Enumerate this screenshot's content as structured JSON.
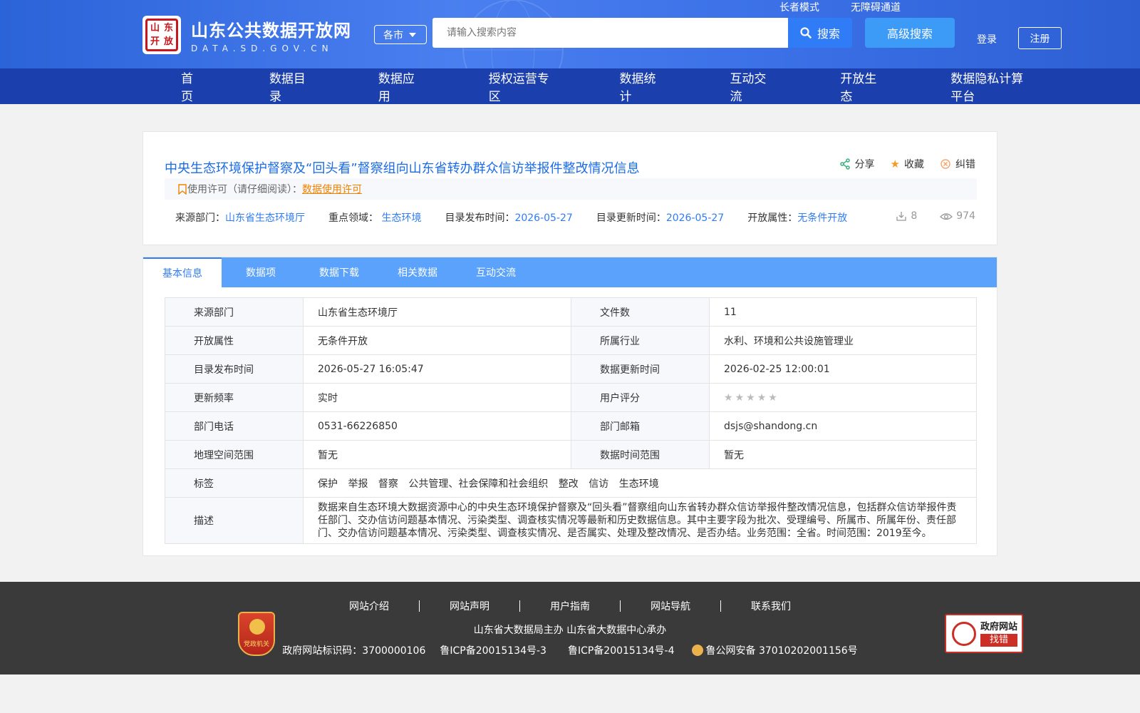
{
  "header": {
    "site_title": "山东公共数据开放网",
    "site_domain": "DATA.SD.GOV.CN",
    "logo_seal_chars": [
      "山",
      "东",
      "开",
      "放"
    ],
    "elder_mode": "长者模式",
    "accessibility": "无障碍通道",
    "city_select": "各市",
    "search_placeholder": "请输入搜索内容",
    "search_button": "搜索",
    "advanced_search": "高级搜索",
    "login": "登录",
    "register": "注册"
  },
  "nav": {
    "items": [
      "首页",
      "数据目录",
      "数据应用",
      "授权运营专区",
      "数据统计",
      "互动交流",
      "开放生态",
      "数据隐私计算平台"
    ]
  },
  "dataset": {
    "title": "中央生态环境保护督察及“回头看”督察组向山东省转办群众信访举报件整改情况信息",
    "share": "分享",
    "favorite": "收藏",
    "report": "纠错",
    "license_prefix": "使用许可（请仔细阅读）：",
    "license_link": "数据使用许可",
    "meta": {
      "source_label": "来源部门：",
      "source_value": "山东省生态环境厅",
      "domain_label": "重点领域：",
      "domain_value": "生态环境",
      "publish_label": "目录发布时间：",
      "publish_value": "2026-05-27",
      "update_label": "目录更新时间：",
      "update_value": "2026-05-27",
      "open_label": "开放属性：",
      "open_value": "无条件开放",
      "downloads": "8",
      "views": "974"
    }
  },
  "tabs": [
    "基本信息",
    "数据项",
    "数据下载",
    "相关数据",
    "互动交流"
  ],
  "details": {
    "rows": [
      {
        "k1": "来源部门",
        "v1": "山东省生态环境厅",
        "k2": "文件数",
        "v2": "11"
      },
      {
        "k1": "开放属性",
        "v1": "无条件开放",
        "k2": "所属行业",
        "v2": "水利、环境和公共设施管理业"
      },
      {
        "k1": "目录发布时间",
        "v1": "2026-05-27 16:05:47",
        "k2": "数据更新时间",
        "v2": "2026-02-25 12:00:01"
      },
      {
        "k1": "更新频率",
        "v1": "实时",
        "k2": "用户评分",
        "v2": ""
      },
      {
        "k1": "部门电话",
        "v1": "0531-66226850",
        "k2": "部门邮箱",
        "v2": "dsjs@shandong.cn"
      },
      {
        "k1": "地理空间范围",
        "v1": "暂无",
        "k2": "数据时间范围",
        "v2": "暂无"
      }
    ],
    "rating": 0,
    "tags_label": "标签",
    "tags": [
      "保护",
      "举报",
      "督察",
      "公共管理、社会保障和社会组织",
      "整改",
      "信访",
      "生态环境"
    ],
    "desc_label": "描述",
    "desc": "数据来自生态环境大数据资源中心的中央生态环境保护督察及“回头看”督察组向山东省转办群众信访举报件整改情况信息，包括群众信访举报件责任部门、交办信访问题基本情况、污染类型、调查核实情况等最新和历史数据信息。其中主要字段为批次、受理编号、所属市、所属年份、责任部门、交办信访问题基本情况、污染类型、调查核实情况、是否属实、处理及整改情况、是否办结。业务范围：全省。时间范围：2019至今。"
  },
  "footer": {
    "links": [
      "网站介绍",
      "网站声明",
      "用户指南",
      "网站导航",
      "联系我们"
    ],
    "sponsor": "山东省大数据局主办   山东省大数据中心承办",
    "gov_id": "政府网站标识码：3700000106",
    "icp1": "鲁ICP备20015134号-3",
    "icp2": "鲁ICP备20015134号-4",
    "police": "鲁公网安备 37010202001156号",
    "party_badge": "党政机关",
    "error_title": "政府网站",
    "error_sub": "找错"
  },
  "colors": {
    "brand_blue": "#1c3fae",
    "link_blue": "#2f7cf6",
    "tab_blue": "#5aa2fb",
    "license_orange": "#f08200"
  }
}
